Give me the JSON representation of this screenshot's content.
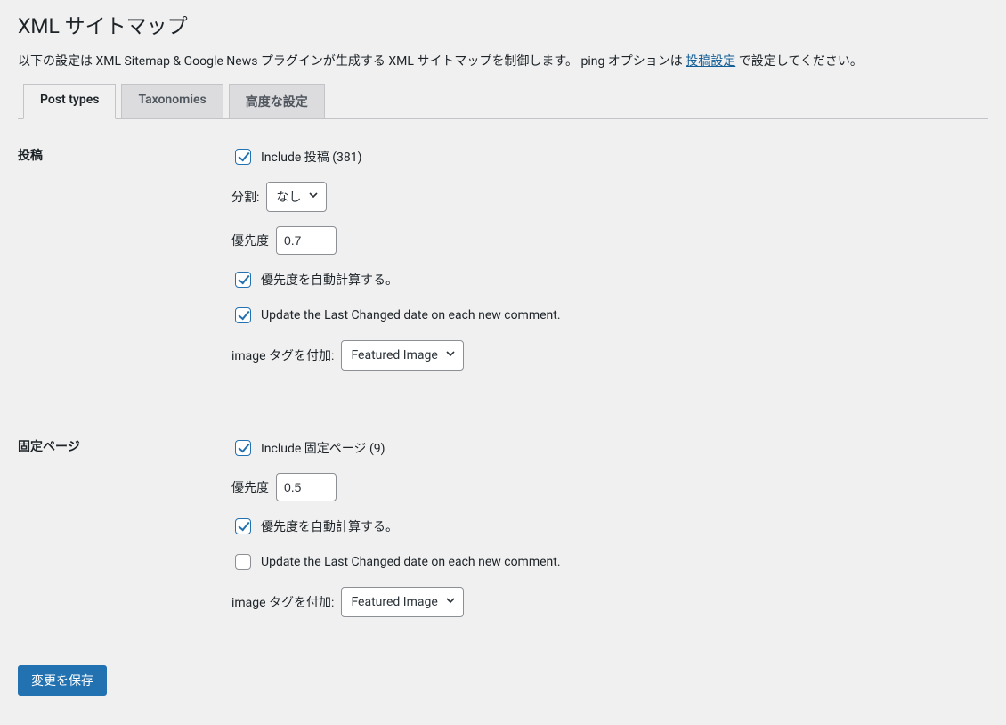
{
  "page": {
    "title": "XML サイトマップ",
    "desc_prefix": "以下の設定は XML Sitemap & Google News プラグインが生成する XML サイトマップを制御します。 ping オプションは ",
    "desc_link": "投稿設定",
    "desc_suffix": " で設定してください。"
  },
  "tabs": {
    "post_types": "Post types",
    "taxonomies": "Taxonomies",
    "advanced": "高度な設定"
  },
  "sections": {
    "posts": {
      "heading": "投稿",
      "include_label": "Include 投稿 (381)",
      "include_checked": true,
      "split_label": "分割:",
      "split_value": "なし",
      "priority_label": "優先度",
      "priority_value": "0.7",
      "auto_priority_label": "優先度を自動計算する。",
      "auto_priority_checked": true,
      "update_lastchanged_label": "Update the Last Changed date on each new comment.",
      "update_lastchanged_checked": true,
      "image_tag_label": "image タグを付加:",
      "image_tag_value": "Featured Image"
    },
    "pages": {
      "heading": "固定ページ",
      "include_label": "Include 固定ページ (9)",
      "include_checked": true,
      "priority_label": "優先度",
      "priority_value": "0.5",
      "auto_priority_label": "優先度を自動計算する。",
      "auto_priority_checked": true,
      "update_lastchanged_label": "Update the Last Changed date on each new comment.",
      "update_lastchanged_checked": false,
      "image_tag_label": "image タグを付加:",
      "image_tag_value": "Featured Image"
    }
  },
  "submit": {
    "label": "変更を保存"
  }
}
